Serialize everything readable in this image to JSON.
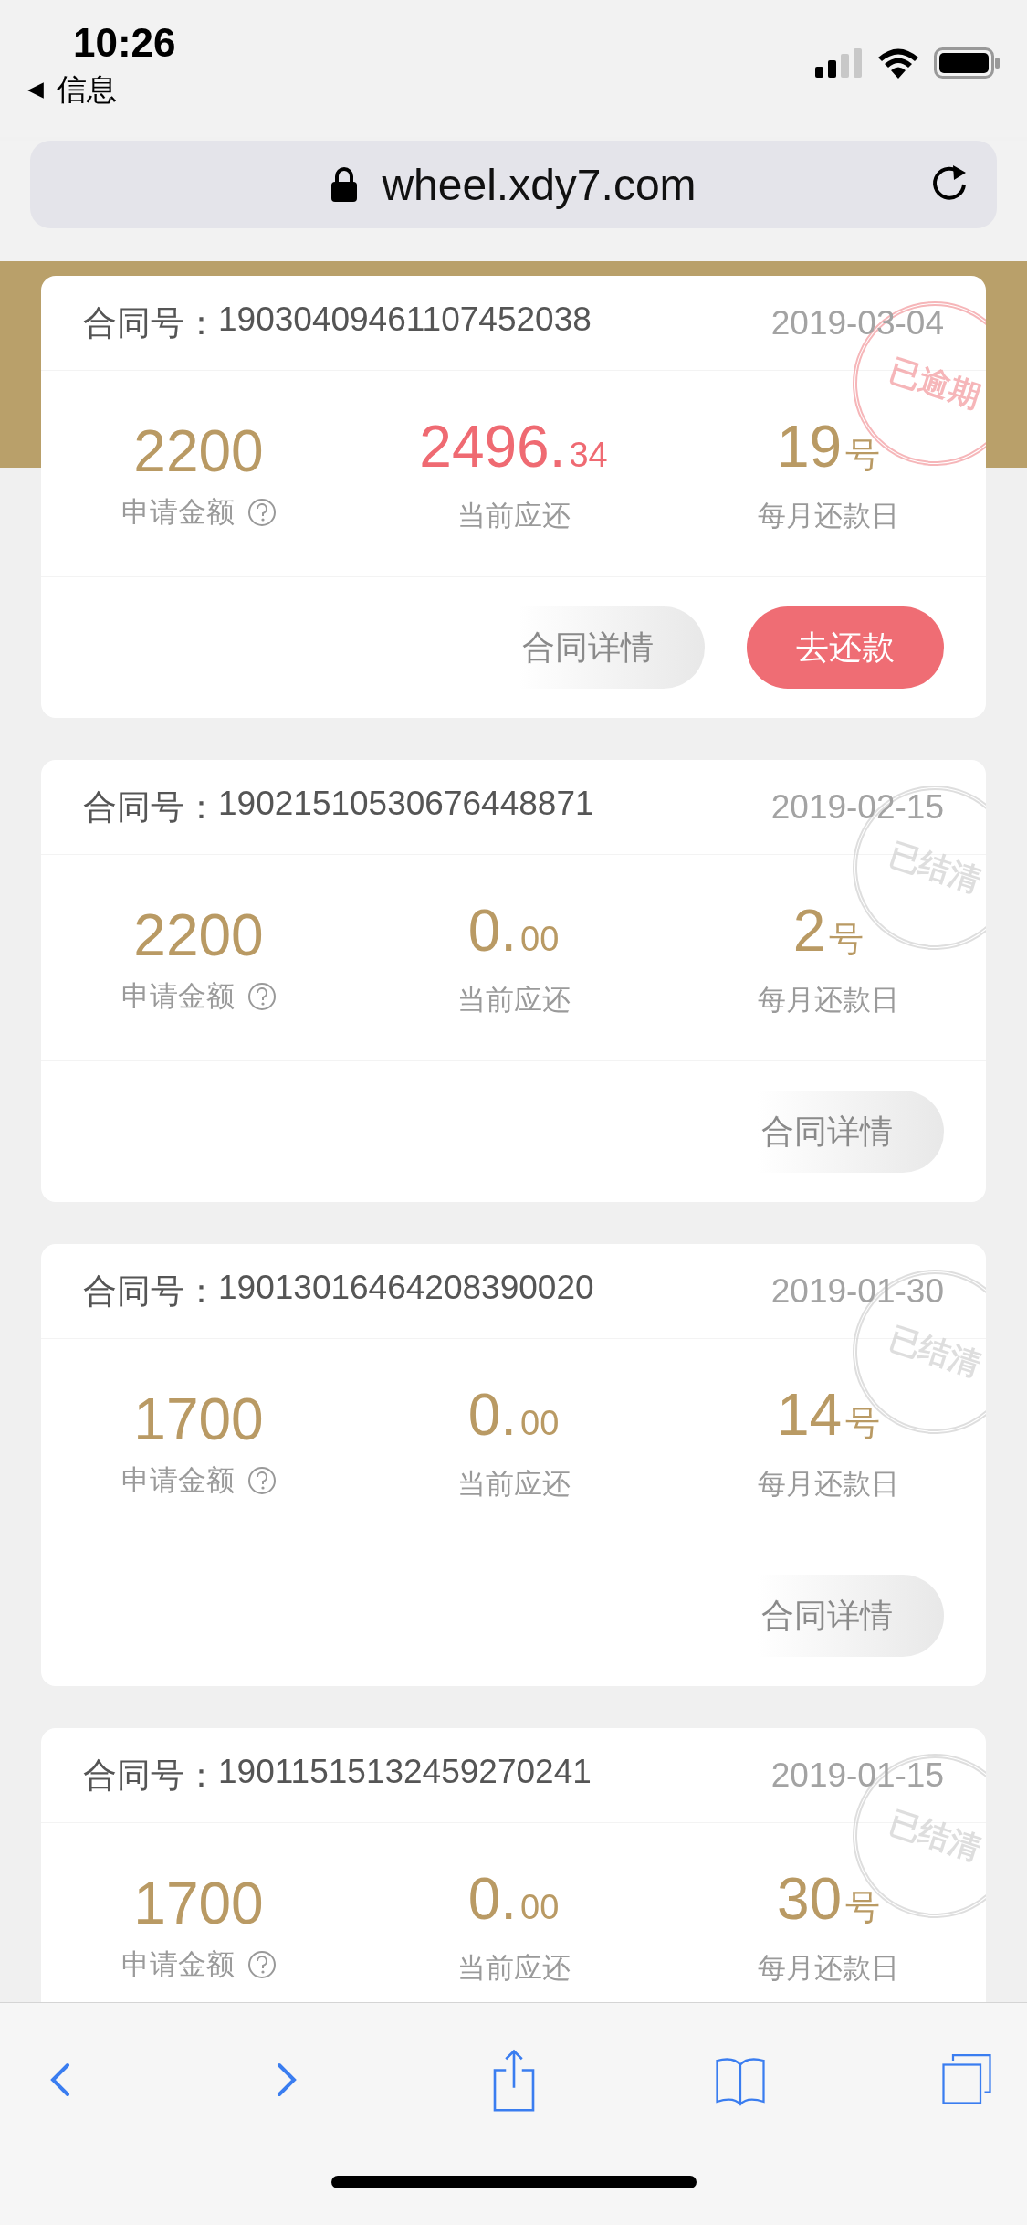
{
  "status_bar": {
    "time": "10:26",
    "back_label": "信息"
  },
  "address_bar": {
    "url": "wheel.xdy7.com"
  },
  "contracts": [
    {
      "number_label": "合同号：",
      "number": "19030409461107452038",
      "date": "2019-03-04",
      "stamp": {
        "text": "已逾期",
        "kind": "overdue"
      },
      "amount": "2200",
      "amount_label": "申请金额",
      "due_whole": "2496.",
      "due_fraction": "34",
      "due_overdue": true,
      "due_label": "当前应还",
      "day": "19",
      "day_unit": "号",
      "day_label": "每月还款日",
      "buttons": [
        {
          "label": "合同详情",
          "kind": "secondary"
        },
        {
          "label": "去还款",
          "kind": "primary"
        }
      ]
    },
    {
      "number_label": "合同号：",
      "number": "19021510530676448871",
      "date": "2019-02-15",
      "stamp": {
        "text": "已结清",
        "kind": "settled"
      },
      "amount": "2200",
      "amount_label": "申请金额",
      "due_whole": "0.",
      "due_fraction": "00",
      "due_overdue": false,
      "due_label": "当前应还",
      "day": "2",
      "day_unit": "号",
      "day_label": "每月还款日",
      "buttons": [
        {
          "label": "合同详情",
          "kind": "secondary"
        }
      ]
    },
    {
      "number_label": "合同号：",
      "number": "19013016464208390020",
      "date": "2019-01-30",
      "stamp": {
        "text": "已结清",
        "kind": "settled"
      },
      "amount": "1700",
      "amount_label": "申请金额",
      "due_whole": "0.",
      "due_fraction": "00",
      "due_overdue": false,
      "due_label": "当前应还",
      "day": "14",
      "day_unit": "号",
      "day_label": "每月还款日",
      "buttons": [
        {
          "label": "合同详情",
          "kind": "secondary"
        }
      ]
    },
    {
      "number_label": "合同号：",
      "number": "19011515132459270241",
      "date": "2019-01-15",
      "stamp": {
        "text": "已结清",
        "kind": "settled"
      },
      "amount": "1700",
      "amount_label": "申请金额",
      "due_whole": "0.",
      "due_fraction": "00",
      "due_overdue": false,
      "due_label": "当前应还",
      "day": "30",
      "day_unit": "号",
      "day_label": "每月还款日"
    }
  ]
}
